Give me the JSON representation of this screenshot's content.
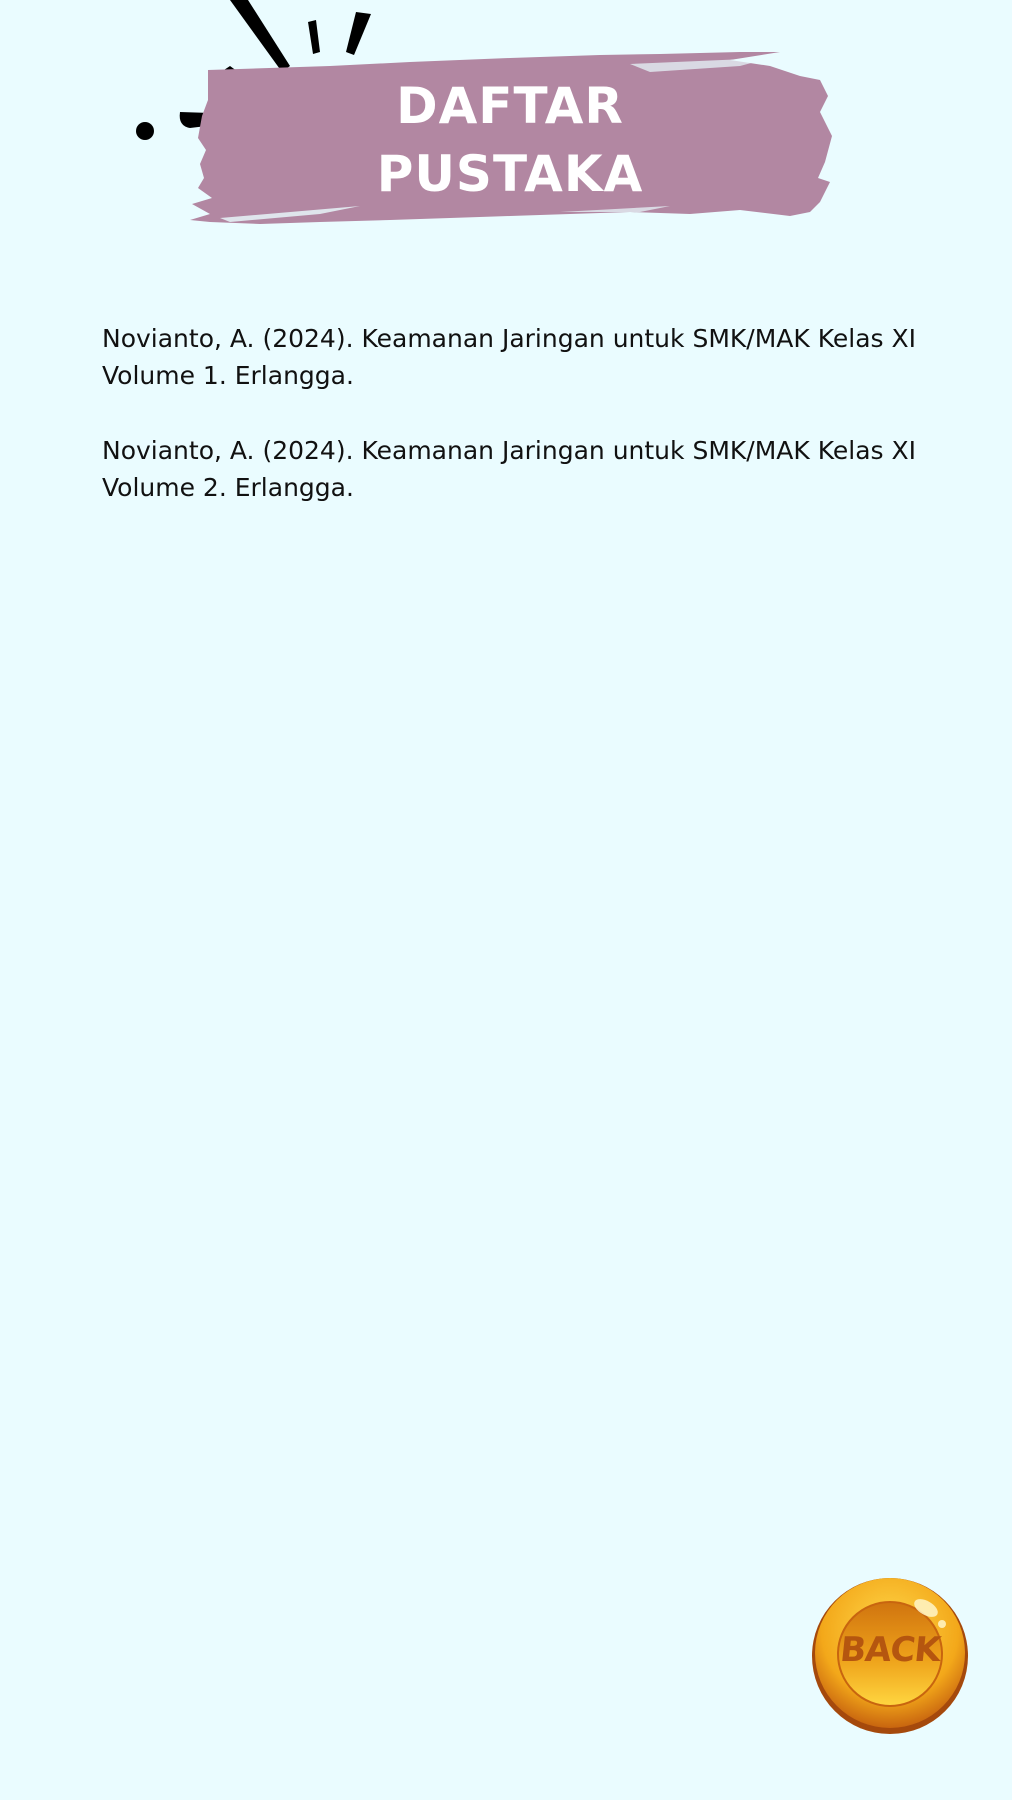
{
  "header": {
    "title_line_1": "DAFTAR",
    "title_line_2": "PUSTAKA",
    "brush_color": "#b287a2"
  },
  "references": [
    {
      "line_1": "Novianto, A. (2024). Keamanan Jaringan untuk SMK/MAK Kelas XI",
      "line_2": "Volume 1. Erlangga."
    },
    {
      "line_1": "Novianto, A. (2024). Keamanan Jaringan untuk SMK/MAK Kelas XI",
      "line_2": "Volume 2. Erlangga."
    }
  ],
  "back_button": {
    "label": "BACK",
    "icon": "gold-coin-icon"
  },
  "colors": {
    "background": "#eafcff",
    "text": "#111111",
    "coin_gold": "#f6b51e",
    "coin_rim": "#c25e12"
  }
}
